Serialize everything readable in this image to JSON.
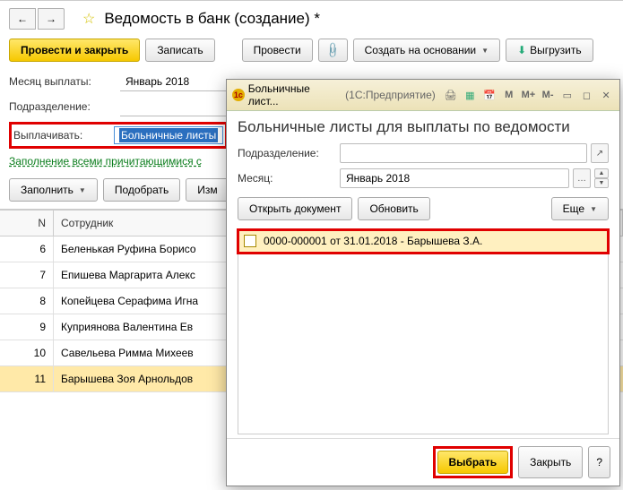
{
  "header": {
    "title": "Ведомость в банк (создание) *"
  },
  "toolbar": {
    "submit": "Провести и закрыть",
    "save": "Записать",
    "post": "Провести",
    "create_based": "Создать на основании",
    "export": "Выгрузить"
  },
  "form": {
    "month_label": "Месяц выплаты:",
    "month_value": "Январь 2018",
    "dept_label": "Подразделение:",
    "dept_value": "",
    "pay_label": "Выплачивать:",
    "pay_value": "Больничные листы",
    "fill_link": "Заполнение всеми причитающимися с"
  },
  "actions2": {
    "fill": "Заполнить",
    "pick": "Подобрать",
    "edit": "Изм"
  },
  "table": {
    "col_n": "N",
    "col_emp": "Сотрудник",
    "rows": [
      {
        "n": "6",
        "emp": "Беленькая Руфина Борисо"
      },
      {
        "n": "7",
        "emp": "Епишева Маргарита Алекс"
      },
      {
        "n": "8",
        "emp": "Копейцева Серафима Игна"
      },
      {
        "n": "9",
        "emp": "Куприянова Валентина Ев"
      },
      {
        "n": "10",
        "emp": "Савельева Римма Михеев"
      },
      {
        "n": "11",
        "emp": "Барышева Зоя Арнольдов"
      }
    ]
  },
  "modal": {
    "win_title_a": "Больничные лист...",
    "win_title_b": "(1С:Предприятие)",
    "heading": "Больничные листы для выплаты по ведомости",
    "dept_label": "Подразделение:",
    "dept_value": "",
    "month_label": "Месяц:",
    "month_value": "Январь 2018",
    "open": "Открыть документ",
    "refresh": "Обновить",
    "more": "Еще",
    "item": "0000-000001 от 31.01.2018 - Барышева З.А.",
    "select": "Выбрать",
    "close": "Закрыть",
    "help": "?"
  }
}
